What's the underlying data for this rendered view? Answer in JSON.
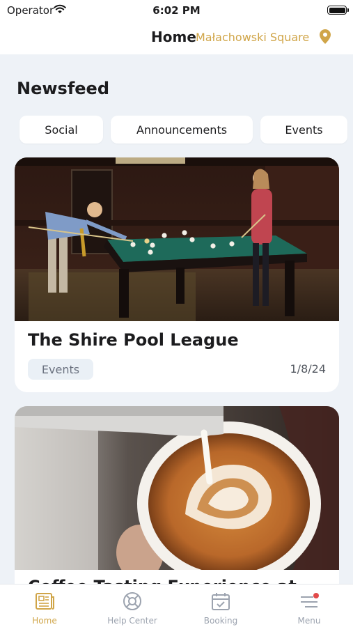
{
  "status_bar": {
    "carrier": "Operator",
    "time": "6:02 PM",
    "icons": [
      "wifi-icon",
      "battery-icon"
    ]
  },
  "header": {
    "title": "Home",
    "location": "Małachowski Square",
    "location_icon": "map-pin-icon"
  },
  "newsfeed": {
    "title": "Newsfeed",
    "tabs": [
      {
        "label": "Social"
      },
      {
        "label": "Announcements"
      },
      {
        "label": "Events"
      }
    ]
  },
  "posts": [
    {
      "title": "The Shire Pool League",
      "category": "Events",
      "date": "1/8/24",
      "image": "people-playing-pool-photo"
    },
    {
      "title": "Coffee Tasting Experience at",
      "image": "latte-art-coffee-photo"
    }
  ],
  "tab_bar": {
    "items": [
      {
        "label": "Home",
        "icon": "newspaper-icon",
        "active": true
      },
      {
        "label": "Help Center",
        "icon": "lifebuoy-icon",
        "active": false
      },
      {
        "label": "Booking",
        "icon": "calendar-check-icon",
        "active": false
      },
      {
        "label": "Menu",
        "icon": "menu-lines-icon",
        "active": false
      }
    ]
  },
  "colors": {
    "accent": "#d0a548",
    "background": "#eef2f7",
    "badge_bg": "#eaf0f6",
    "notification_dot": "#e24a4a"
  }
}
